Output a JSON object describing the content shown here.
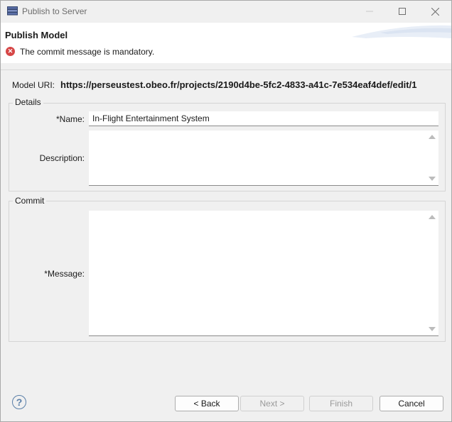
{
  "window": {
    "title": "Publish to Server"
  },
  "header": {
    "title": "Publish Model",
    "error_message": "The commit message is mandatory."
  },
  "model_uri": {
    "label": "Model URI:",
    "value": "https://perseustest.obeo.fr/projects/2190d4be-5fc2-4833-a41c-7e534eaf4def/edit/1"
  },
  "details": {
    "legend": "Details",
    "name_label": "*Name:",
    "name_value": "In-Flight Entertainment System",
    "description_label": "Description:"
  },
  "commit": {
    "legend": "Commit",
    "message_label": "*Message:"
  },
  "buttons": {
    "back": "< Back",
    "next": "Next >",
    "finish": "Finish",
    "cancel": "Cancel"
  },
  "colors": {
    "error": "#d64646",
    "help": "#5a7fa8"
  }
}
